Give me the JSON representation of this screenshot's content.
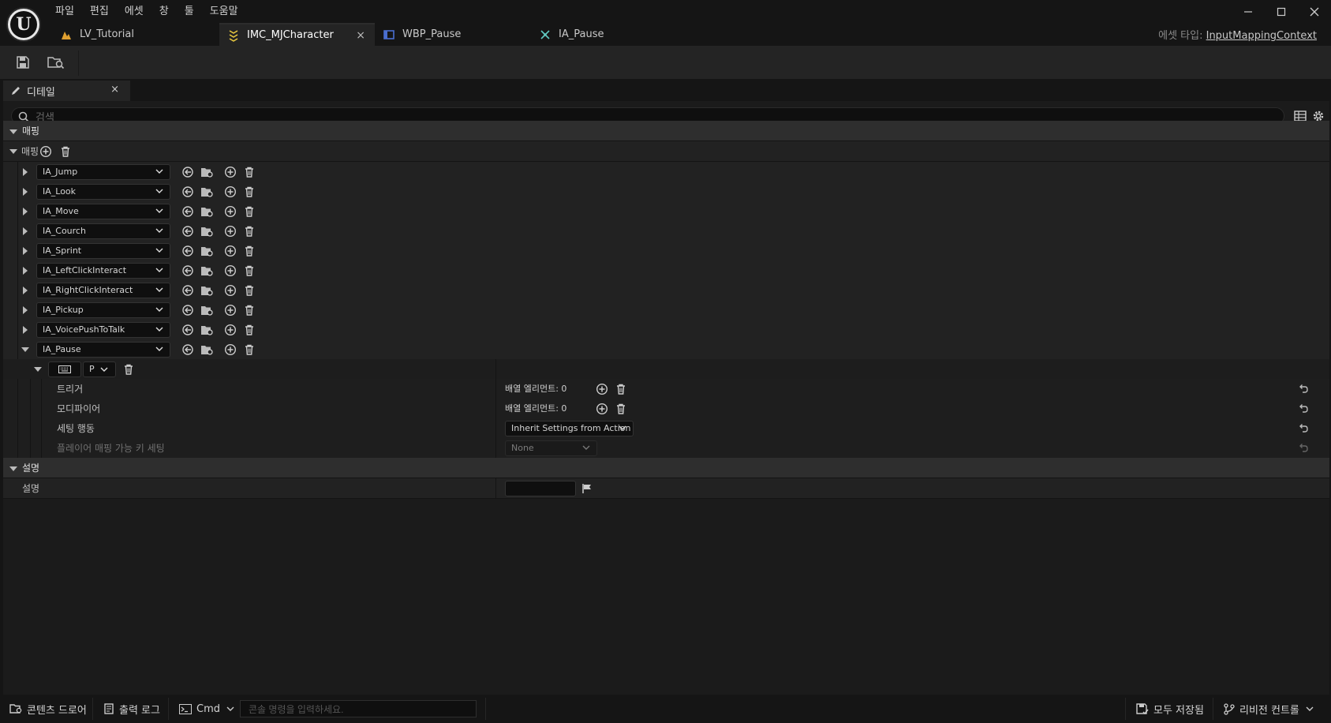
{
  "menu": [
    "파일",
    "편집",
    "에셋",
    "창",
    "툴",
    "도움말"
  ],
  "tabs": [
    {
      "label": "LV_Tutorial",
      "icon": "level-icon",
      "active": false
    },
    {
      "label": "IMC_MJCharacter",
      "icon": "input-mapping-context-icon",
      "active": true
    },
    {
      "label": "WBP_Pause",
      "icon": "widget-blueprint-icon",
      "active": false
    },
    {
      "label": "IA_Pause",
      "icon": "input-action-icon",
      "active": false
    }
  ],
  "asset_type": {
    "label": "에셋 타입:",
    "value": "InputMappingContext"
  },
  "details": {
    "tab_label": "디테일",
    "search_placeholder": "검색",
    "mapping_category": "매핑",
    "mappings_label": "매핑",
    "actions": [
      "IA_Jump",
      "IA_Look",
      "IA_Move",
      "IA_Courch",
      "IA_Sprint",
      "IA_LeftClickInteract",
      "IA_RightClickInteract",
      "IA_Pickup",
      "IA_VoicePushToTalk",
      "IA_Pause"
    ],
    "expanded_action": "IA_Pause",
    "key_binding": {
      "key": "P"
    },
    "properties": [
      {
        "label": "트리거",
        "value": "배열 엘리먼트: 0"
      },
      {
        "label": "모디파이어",
        "value": "배열 엘리먼트: 0"
      },
      {
        "label": "세팅 행동",
        "value": "Inherit Settings from Action"
      },
      {
        "label": "플레이어 매핑 가능 키 세팅",
        "value": "None"
      }
    ],
    "description_category": "설명",
    "description_label": "설명",
    "description_value": ""
  },
  "statusbar": {
    "content_drawer": "콘텐츠 드로어",
    "output_log": "출력 로그",
    "cmd": "Cmd",
    "console_placeholder": "콘솔 명령을 입력하세요.",
    "save_all": "모두 저장됨",
    "revision_control": "리비전 컨트롤"
  },
  "colors": {
    "background": "#151515",
    "panel": "#242424",
    "details": "#1b1b1b",
    "active_tab": "#242424"
  }
}
